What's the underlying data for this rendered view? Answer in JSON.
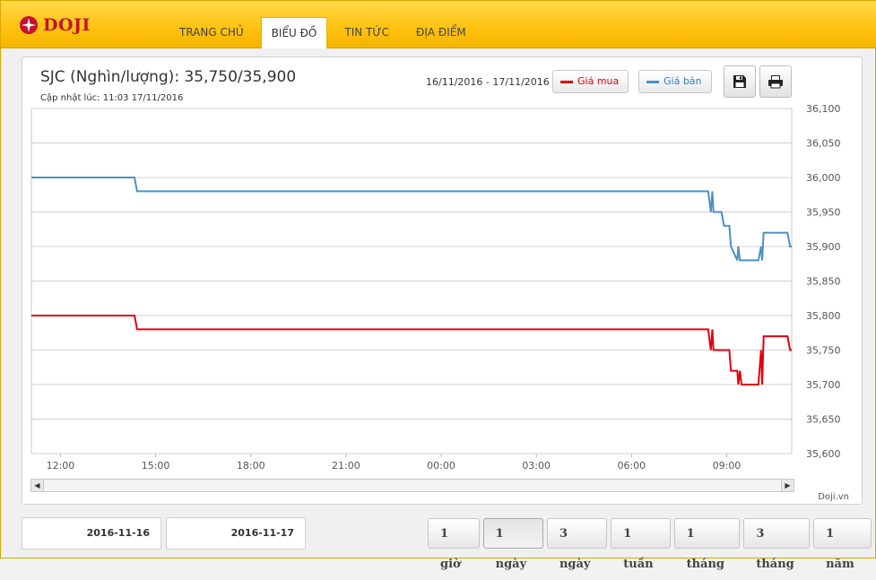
{
  "brand": {
    "name": "DOJI",
    "logo_color": "#c8102e"
  },
  "nav": [
    {
      "label": "TRANG CHỦ",
      "active": false
    },
    {
      "label": "BIỂU ĐỒ",
      "active": true
    },
    {
      "label": "TIN TỨC",
      "active": false
    },
    {
      "label": "ĐỊA ĐIỂM",
      "active": false
    }
  ],
  "header": {
    "title": "SJC (Nghìn/lượng): 35,750/35,900",
    "updated": "Cập nhật lúc: 11:03 17/11/2016",
    "date_range": "16/11/2016 - 17/11/2016",
    "legend_buy": "Giá mua",
    "legend_sell": "Giá bán",
    "save_icon": "floppy-disk-icon",
    "print_icon": "printer-icon"
  },
  "credit": "Doji.vn",
  "footer": {
    "date_from": "2016-11-16",
    "date_to": "2016-11-17",
    "ranges": [
      {
        "label": "1 giờ",
        "active": false
      },
      {
        "label": "1 ngày",
        "active": true
      },
      {
        "label": "3 ngày",
        "active": false
      },
      {
        "label": "1 tuần",
        "active": false
      },
      {
        "label": "1 tháng",
        "active": false
      },
      {
        "label": "3 tháng",
        "active": false
      },
      {
        "label": "1 năm",
        "active": false
      }
    ]
  },
  "colors": {
    "buy": "#e3000f",
    "sell": "#4a90c2",
    "accent": "#ffc20e"
  },
  "chart_data": {
    "type": "line",
    "x_unit": "time of day (hour:min)",
    "xlim": [
      "11:05",
      "11:03"
    ],
    "x_ticks": [
      "12:00",
      "15:00",
      "18:00",
      "21:00",
      "00:00",
      "03:00",
      "06:00",
      "09:00"
    ],
    "ylim": [
      35600,
      36100
    ],
    "y_ticks": [
      "36,100",
      "36,050",
      "36,000",
      "35,950",
      "35,900",
      "35,850",
      "35,800",
      "35,750",
      "35,700",
      "35,650",
      "35,600"
    ],
    "grid": true,
    "legend_position": "top-right",
    "series": [
      {
        "name": "Giá bán",
        "color": "#4a90c2",
        "points": [
          [
            "11:05",
            36000
          ],
          [
            "14:20",
            36000
          ],
          [
            "14:25",
            35980
          ],
          [
            "08:25",
            35980
          ],
          [
            "08:30",
            35950
          ],
          [
            "08:33",
            35980
          ],
          [
            "08:35",
            35950
          ],
          [
            "08:50",
            35950
          ],
          [
            "08:55",
            35930
          ],
          [
            "09:05",
            35930
          ],
          [
            "09:08",
            35900
          ],
          [
            "09:20",
            35880
          ],
          [
            "09:22",
            35900
          ],
          [
            "09:25",
            35880
          ],
          [
            "10:00",
            35880
          ],
          [
            "10:05",
            35900
          ],
          [
            "10:07",
            35880
          ],
          [
            "10:10",
            35920
          ],
          [
            "10:55",
            35920
          ],
          [
            "11:00",
            35900
          ],
          [
            "11:03",
            35900
          ]
        ]
      },
      {
        "name": "Giá mua",
        "color": "#e3000f",
        "points": [
          [
            "11:05",
            35800
          ],
          [
            "14:20",
            35800
          ],
          [
            "14:25",
            35780
          ],
          [
            "08:25",
            35780
          ],
          [
            "08:30",
            35750
          ],
          [
            "08:33",
            35780
          ],
          [
            "08:35",
            35750
          ],
          [
            "09:05",
            35750
          ],
          [
            "09:08",
            35720
          ],
          [
            "09:20",
            35720
          ],
          [
            "09:22",
            35700
          ],
          [
            "09:25",
            35720
          ],
          [
            "09:28",
            35700
          ],
          [
            "10:00",
            35700
          ],
          [
            "10:05",
            35750
          ],
          [
            "10:07",
            35700
          ],
          [
            "10:10",
            35770
          ],
          [
            "10:55",
            35770
          ],
          [
            "11:00",
            35750
          ],
          [
            "11:03",
            35750
          ]
        ]
      }
    ]
  }
}
